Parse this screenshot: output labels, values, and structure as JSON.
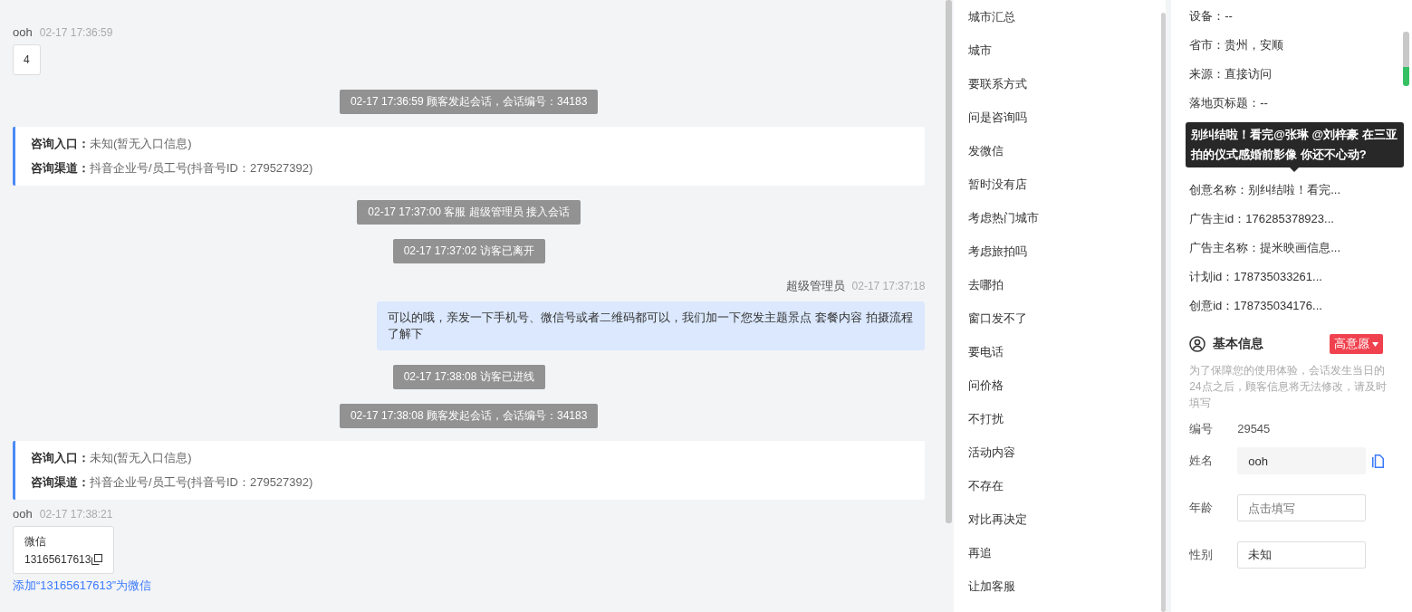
{
  "chat": {
    "messages": [
      {
        "kind": "visitor",
        "name": "ooh",
        "time": "02-17 17:36:59",
        "text": "4"
      },
      {
        "kind": "system",
        "text": "02-17 17:36:59 顾客发起会话，会话编号：34183"
      },
      {
        "kind": "source",
        "fields": [
          {
            "label": "咨询入口：",
            "value": "未知(暂无入口信息)"
          },
          {
            "label": "咨询渠道：",
            "value": "抖音企业号/员工号(抖音号ID：279527392)"
          }
        ]
      },
      {
        "kind": "system",
        "text": "02-17 17:37:00 客服 超级管理员 接入会话"
      },
      {
        "kind": "system",
        "text": "02-17 17:37:02 访客已离开"
      },
      {
        "kind": "agent",
        "name": "超级管理员",
        "time": "02-17 17:37:18",
        "text": "可以的哦，亲发一下手机号、微信号或者二维码都可以，我们加一下您发主题景点 套餐内容 拍摄流程了解下"
      },
      {
        "kind": "system",
        "text": "02-17 17:38:08 访客已进线"
      },
      {
        "kind": "system",
        "text": "02-17 17:38:08 顾客发起会话，会话编号：34183"
      },
      {
        "kind": "source",
        "fields": [
          {
            "label": "咨询入口：",
            "value": "未知(暂无入口信息)"
          },
          {
            "label": "咨询渠道：",
            "value": "抖音企业号/员工号(抖音号ID：279527392)"
          }
        ]
      },
      {
        "kind": "contact_card",
        "name": "ooh",
        "time": "02-17 17:38:21",
        "title": "微信",
        "value": "13165617613"
      }
    ],
    "add_link": "添加“13165617613”为微信"
  },
  "quick_replies": [
    "城市汇总",
    "城市",
    "要联系方式",
    "问是咨询吗",
    "发微信",
    "暂时没有店",
    "考虑热门城市",
    "考虑旅拍吗",
    "去哪拍",
    "窗口发不了",
    "要电话",
    "问价格",
    "不打扰",
    "活动内容",
    "不存在",
    "对比再决定",
    "再追",
    "让加客服"
  ],
  "visitor_info": {
    "rows_before": [
      "设备：--",
      "省市：贵州，安顺",
      "来源：直接访问",
      "落地页标题：--"
    ],
    "tooltip": "别纠结啦！看完@张琳 @刘梓豪 在三亚拍的仪式感婚前影像 你还不心动?",
    "rows_after": [
      "创意名称：别纠结啦！看完...",
      "广告主id：176285378923...",
      "广告主名称：提米映画信息...",
      "计划id：178735033261...",
      "创意id：178735034176..."
    ]
  },
  "basic_info": {
    "title": "基本信息",
    "intent": "高意愿",
    "notice": "为了保障您的使用体验，会话发生当日的24点之后，顾客信息将无法修改，请及时填写",
    "fields": [
      {
        "kind": "text",
        "label": "编号",
        "value": "29545"
      },
      {
        "kind": "readonly",
        "label": "姓名",
        "value": "ooh"
      },
      {
        "kind": "input",
        "label": "年龄",
        "placeholder": "点击填写"
      },
      {
        "kind": "select",
        "label": "性别",
        "value": "未知"
      }
    ]
  }
}
